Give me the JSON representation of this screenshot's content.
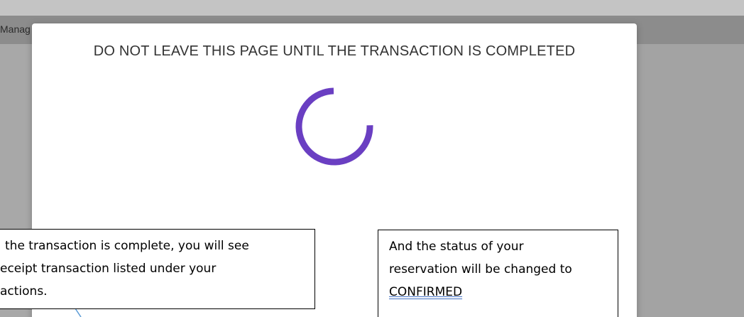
{
  "background": {
    "header_text": "Manag"
  },
  "modal": {
    "title": "DO NOT LEAVE THIS PAGE UNTIL THE TRANSACTION IS COMPLETED",
    "spinner_icon": "loading-spinner-icon",
    "spinner_color": "#6a3fc2"
  },
  "callouts": {
    "left": {
      "lines": [
        " the transaction is complete, you will see",
        "eceipt transaction listed under your",
        "actions."
      ]
    },
    "right": {
      "lines": [
        "And the status of your",
        "reservation will be changed to"
      ],
      "status_word": "CONFIRMED"
    }
  }
}
